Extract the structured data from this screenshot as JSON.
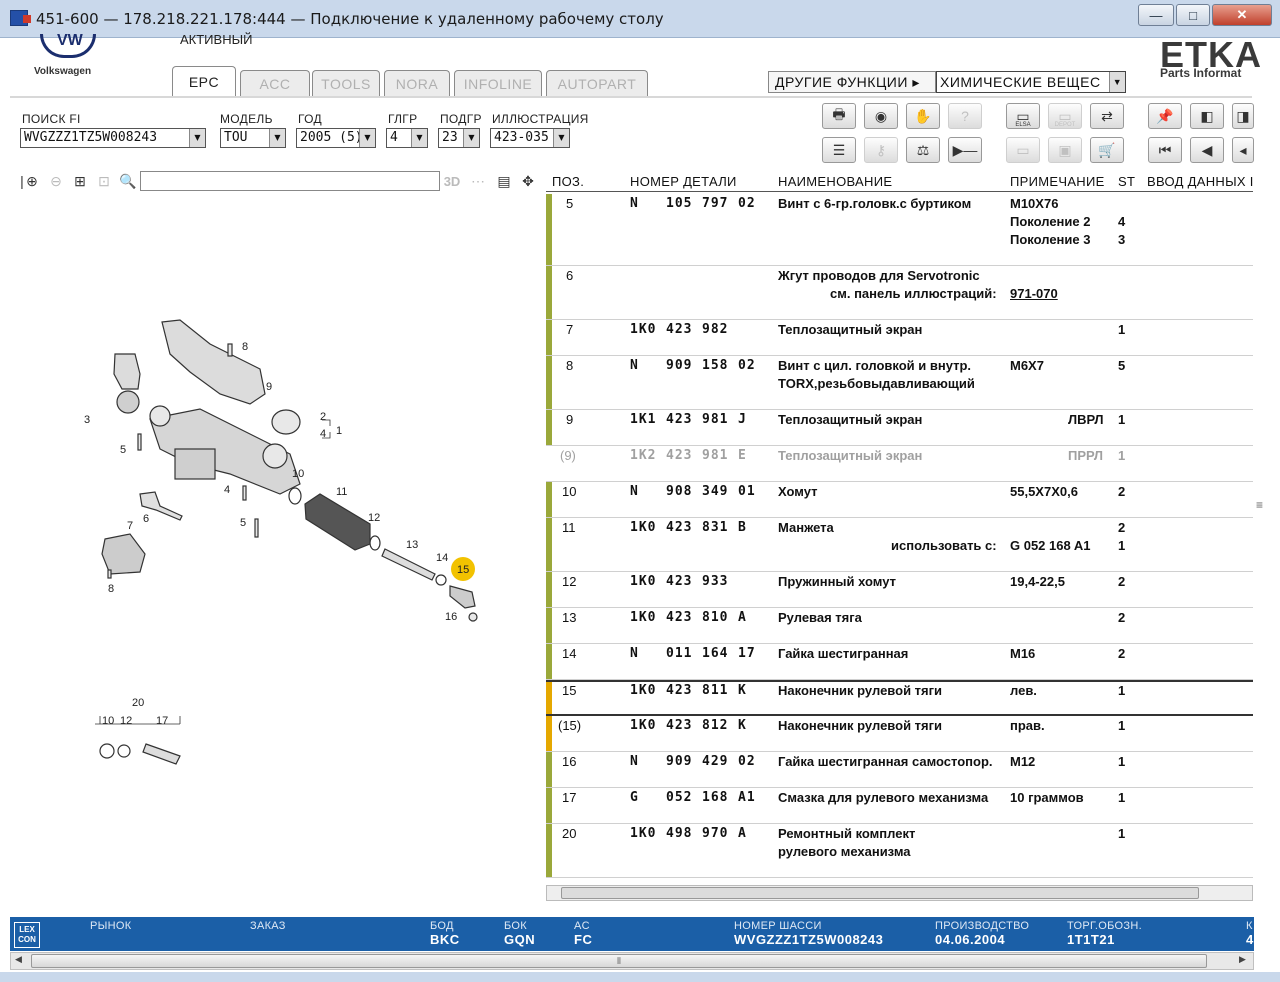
{
  "window": {
    "title": "451-600 — 178.218.221.178:444 — Подключение к удаленному рабочему столу",
    "minimize": "—",
    "maximize": "□",
    "close": "✕"
  },
  "header": {
    "brand": "Volkswagen",
    "brand_logo_text": "VW",
    "active_label": "АКТИВНЫЙ",
    "etka": "ETKA",
    "etka_sub": "Parts Informat",
    "tabs": [
      "EPC",
      "ACC",
      "TOOLS",
      "NORA",
      "INFOLINE",
      "AUTOPART"
    ],
    "other_functions": "ДРУГИЕ ФУНКЦИИ ▸",
    "chemicals": "ХИМИЧЕСКИЕ ВЕЩЕС"
  },
  "filters": {
    "search_fi": {
      "label": "ПОИСК FI",
      "value": "WVGZZZ1TZ5W008243"
    },
    "model": {
      "label": "МОДЕЛЬ",
      "value": "TOU"
    },
    "year": {
      "label": "ГОД",
      "value": "2005 (5)"
    },
    "main_group": {
      "label": "ГЛГР",
      "value": "4"
    },
    "sub_group": {
      "label": "ПОДГР",
      "value": "23"
    },
    "illustration": {
      "label": "ИЛЛЮСТРАЦИЯ",
      "value": "423-035"
    }
  },
  "toolbar": {
    "elsa": "ELSA",
    "depot": "DEPOT"
  },
  "table": {
    "headers": {
      "pos": "ПОЗ.",
      "part_no": "НОМЕР ДЕТАЛИ",
      "name": "НАИМЕНОВАНИЕ",
      "note": "ПРИМЕЧАНИЕ",
      "st": "ST",
      "input": "ВВОД ДАННЫХ І"
    },
    "rows": [
      {
        "pos": "5",
        "p1": "N",
        "p2": "105",
        "p3": "797",
        "p4": "02",
        "name": [
          "Винт с 6-гр.головк.с буртиком"
        ],
        "notes": [
          "M10X76",
          "Поколение 2",
          "Поколение 3"
        ],
        "st": [
          "",
          "4",
          "3"
        ]
      },
      {
        "pos": "6",
        "p1": "",
        "p2": "",
        "p3": "",
        "p4": "",
        "name": [
          "Жгут проводов для Servotronic"
        ],
        "sub": "см. панель иллюстраций:",
        "link": "971-070",
        "notes": [],
        "st": []
      },
      {
        "pos": "7",
        "p1": "1K0",
        "p2": "423",
        "p3": "982",
        "p4": "",
        "name": [
          "Теплозащитный экран"
        ],
        "notes": [
          ""
        ],
        "st": [
          "1"
        ]
      },
      {
        "pos": "8",
        "p1": "N",
        "p2": "909",
        "p3": "158",
        "p4": "02",
        "name": [
          "Винт с цил. головкой и внутр.",
          "TORX,резьбовыдавливающий"
        ],
        "notes": [
          "M6X7"
        ],
        "st": [
          "5"
        ]
      },
      {
        "pos": "9",
        "p1": "1K1",
        "p2": "423",
        "p3": "981",
        "p4": "J",
        "name": [
          "Теплозащитный экран"
        ],
        "side": "ЛВРЛ",
        "notes": [
          ""
        ],
        "st": [
          "1"
        ]
      },
      {
        "pos": "(9)",
        "p1": "1K2",
        "p2": "423",
        "p3": "981",
        "p4": "E",
        "name": [
          "Теплозащитный экран"
        ],
        "side": "ПРРЛ",
        "notes": [
          ""
        ],
        "st": [
          "1"
        ],
        "gray": true
      },
      {
        "pos": "10",
        "p1": "N",
        "p2": "908",
        "p3": "349",
        "p4": "01",
        "name": [
          "Хомут"
        ],
        "notes": [
          "55,5X7X0,6"
        ],
        "st": [
          "2"
        ]
      },
      {
        "pos": "11",
        "p1": "1K0",
        "p2": "423",
        "p3": "831",
        "p4": "B",
        "name": [
          "Манжета"
        ],
        "use": "использовать с:",
        "use_val": "G   052 168 A1",
        "notes": [
          ""
        ],
        "st": [
          "2",
          "1"
        ]
      },
      {
        "pos": "12",
        "p1": "1K0",
        "p2": "423",
        "p3": "933",
        "p4": "",
        "name": [
          "Пружинный хомут"
        ],
        "notes": [
          "19,4-22,5"
        ],
        "st": [
          "2"
        ]
      },
      {
        "pos": "13",
        "p1": "1K0",
        "p2": "423",
        "p3": "810",
        "p4": "A",
        "name": [
          "Рулевая тяга"
        ],
        "notes": [
          ""
        ],
        "st": [
          "2"
        ]
      },
      {
        "pos": "14",
        "p1": "N",
        "p2": "011",
        "p3": "164",
        "p4": "17",
        "name": [
          "Гайка шестигранная"
        ],
        "notes": [
          "M16"
        ],
        "st": [
          "2"
        ]
      },
      {
        "pos": "15",
        "p1": "1K0",
        "p2": "423",
        "p3": "811",
        "p4": "K",
        "name": [
          "Наконечник рулевой тяги"
        ],
        "notes": [
          "лев."
        ],
        "st": [
          "1"
        ],
        "selected": true
      },
      {
        "pos": "(15)",
        "p1": "1K0",
        "p2": "423",
        "p3": "812",
        "p4": "K",
        "name": [
          "Наконечник рулевой тяги"
        ],
        "notes": [
          "прав."
        ],
        "st": [
          "1"
        ],
        "alt": true
      },
      {
        "pos": "16",
        "p1": "N",
        "p2": "909",
        "p3": "429",
        "p4": "02",
        "name": [
          "Гайка шестигранная самостопор."
        ],
        "notes": [
          "M12"
        ],
        "st": [
          "1"
        ]
      },
      {
        "pos": "17",
        "p1": "G",
        "p2": "052",
        "p3": "168",
        "p4": "A1",
        "name": [
          "Смазка для рулевого механизма"
        ],
        "notes": [
          "10 граммов"
        ],
        "st": [
          "1"
        ]
      },
      {
        "pos": "20",
        "p1": "1K0",
        "p2": "498",
        "p3": "970",
        "p4": "A",
        "name": [
          "Ремонтный комплект",
          "рулевого механизма"
        ],
        "notes": [
          ""
        ],
        "st": [
          "1"
        ]
      }
    ]
  },
  "diagram": {
    "labels": [
      "8",
      "9",
      "2",
      "4",
      "1",
      "3",
      "5",
      "10",
      "11",
      "4",
      "12",
      "6",
      "13",
      "14",
      "15",
      "16",
      "7",
      "5",
      "8",
      "20",
      "10",
      "12",
      "17"
    ]
  },
  "status": {
    "lex": "LEX CON",
    "market": "РЫНОК",
    "order": "ЗАКАЗ",
    "bod_label": "БОД",
    "bod": "BKC",
    "bok_label": "БОК",
    "bok": "GQN",
    "ac_label": "AC",
    "ac": "FC",
    "chassis_label": "НОМЕР ШАССИ",
    "chassis": "WVGZZZ1TZ5W008243",
    "production_label": "ПРОИЗВОДСТВО",
    "production": "04.06.2004",
    "trade_label": "ТОРГ.ОБОЗН.",
    "trade": "1T1T21",
    "k_label": "К",
    "k": "4"
  }
}
